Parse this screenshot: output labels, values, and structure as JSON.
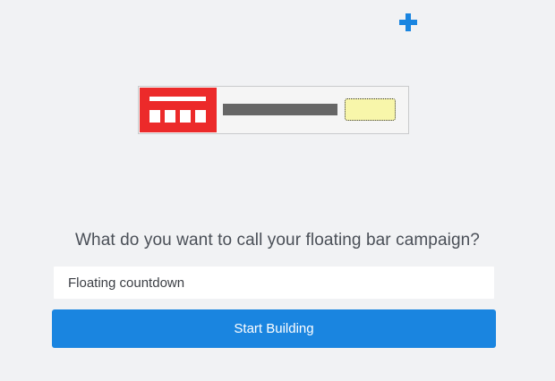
{
  "icons": {
    "add": "plus-icon"
  },
  "colors": {
    "page_background": "#f1f2f4",
    "accent": "#1a85e0",
    "countdown_red": "#ec2a2a",
    "cta_yellow": "#f8f6aa",
    "question_text": "#4a4f57"
  },
  "preview": {
    "type": "floating-bar-illustration"
  },
  "form": {
    "question": "What do you want to call your floating bar campaign?",
    "name_value": "Floating countdown",
    "button_label": "Start Building"
  }
}
